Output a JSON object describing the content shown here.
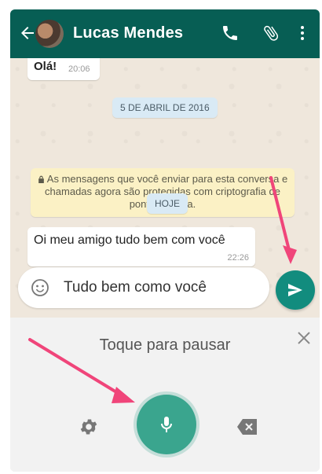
{
  "header": {
    "contact_name": "Lucas Mendes",
    "icons": [
      "back-arrow-icon",
      "phone-icon",
      "paperclip-icon",
      "more-vert-icon"
    ],
    "color": "#075e54"
  },
  "messages": {
    "first": {
      "text": "Olá!",
      "time": "20:06"
    },
    "date_separator": "5 DE ABRIL DE 2016",
    "encryption_notice": "As mensagens que você enviar para esta conversa e chamadas agora são protegidas com criptografia de ponta-a-ponta.",
    "today_separator": "HOJE",
    "second": {
      "text": "Oi meu amigo tudo bem com você",
      "time": "22:26"
    }
  },
  "composer": {
    "text": "Tudo bem como você",
    "emoji_icon": "emoji-icon",
    "send_icon": "send-icon"
  },
  "voice_panel": {
    "prompt": "Toque para pausar",
    "icons": [
      "close-icon",
      "settings-icon",
      "mic-icon",
      "backspace-icon"
    ]
  },
  "accent": "#128c7e",
  "annotation_color": "#f0457a"
}
